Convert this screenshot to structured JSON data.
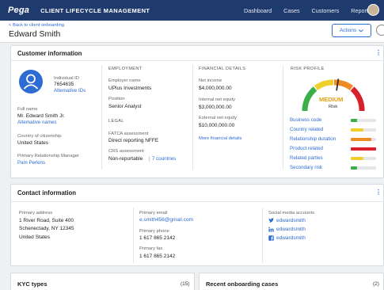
{
  "topnav": {
    "logo": "Pega",
    "app_name": "CLIENT LIFECYCLE MANAGEMENT",
    "links": [
      "Dashboard",
      "Cases",
      "Customers",
      "Reports"
    ]
  },
  "header": {
    "back_link": "< Back to client onboarding",
    "title": "Edward Smith",
    "actions_label": "Actions"
  },
  "customer_info": {
    "title": "Customer information",
    "individual_id_label": "Individual ID",
    "individual_id": "7654635",
    "alternative_ids": "Alternative IDs",
    "full_name_label": "Full name",
    "full_name": "Mr. Edward Smith Jr.",
    "alternative_names": "Alternative names",
    "citizenship_label": "Country of citizenship",
    "citizenship": "United States",
    "rm_label": "Primary Relationship Manager",
    "rm": "Pam Perkins",
    "employment": {
      "heading": "EMPLOYMENT",
      "employer_label": "Employer name",
      "employer": "UPlus Investments",
      "position_label": "Position",
      "position": "Senior Analyst"
    },
    "legal": {
      "heading": "LEGAL",
      "fatca_label": "FATCA assessment",
      "fatca": "Direct reporting NFFE",
      "crs_label": "CRS assessment",
      "crs": "Non-reportable",
      "crs_sep": "|",
      "crs_countries": "7 countries"
    },
    "financial": {
      "heading": "FINANCIAL DETAILS",
      "net_income_label": "Net income",
      "net_income": "$4,000,000.00",
      "internal_equity_label": "Internal net equity",
      "internal_equity": "$3,000,000.00",
      "external_equity_label": "External net equity",
      "external_equity": "$10,000,000.00",
      "more_link": "More financial details"
    },
    "risk": {
      "heading": "RISK PROFILE",
      "gauge_value": "MEDIUM",
      "gauge_sub": "Risk",
      "gauge_level": 0.55,
      "rows": [
        {
          "name": "Business code",
          "level": 0.25,
          "color": "#3cae4a"
        },
        {
          "name": "Country related",
          "level": 0.5,
          "color": "#f0cf2c"
        },
        {
          "name": "Relationship duration",
          "level": 0.8,
          "color": "#f08a24"
        },
        {
          "name": "Product related",
          "level": 1.0,
          "color": "#d8202a"
        },
        {
          "name": "Related parties",
          "level": 0.5,
          "color": "#f0cf2c"
        },
        {
          "name": "Secondary risk",
          "level": 0.25,
          "color": "#3cae4a"
        }
      ]
    }
  },
  "contact_info": {
    "title": "Contact information",
    "address_label": "Primary address",
    "address_line1": "1 River Road, Suite 400",
    "address_line2": "Schenectady, NY 12345",
    "address_line3": "United States",
    "email_label": "Primary email",
    "email": "e.smith456@gmail.com",
    "phone_label": "Primary phone",
    "phone": "1 617 865 2142",
    "fax_label": "Primary fax",
    "fax": "1 617 865 2142",
    "social_label": "Social media accounts",
    "social": [
      "edwardsmith",
      "edwardsmith",
      "edwardsmith"
    ]
  },
  "kyc": {
    "title": "KYC types",
    "count": "(15)"
  },
  "recent_cases": {
    "title": "Recent onboarding cases",
    "count": "(2)"
  },
  "colors": {
    "brand": "#1f3b6e",
    "link": "#2d6cd3"
  }
}
